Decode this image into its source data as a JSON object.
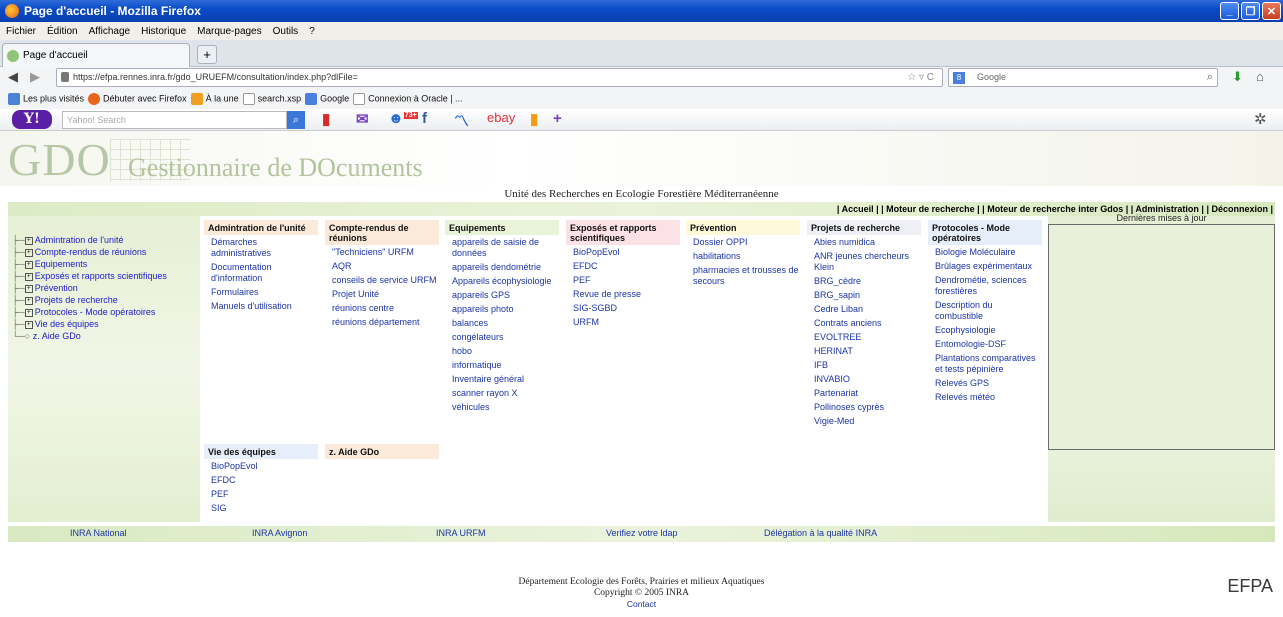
{
  "window": {
    "title": "Page d'accueil - Mozilla Firefox"
  },
  "menubar": [
    "Fichier",
    "Édition",
    "Affichage",
    "Historique",
    "Marque-pages",
    "Outils",
    "?"
  ],
  "tab": {
    "label": "Page d'accueil",
    "new_tab": "+"
  },
  "nav": {
    "url": "https://efpa.rennes.inra.fr/gdo_URUEFM/consultation/index.php?dlFile=",
    "search_placeholder": "Google"
  },
  "bookmarks": [
    "Les plus visités",
    "Débuter avec Firefox",
    "À la une",
    "search.xsp",
    "Google",
    "Connexion à Oracle | ..."
  ],
  "yahoo": {
    "search_placeholder": "Yahoo! Search",
    "badge": "73+"
  },
  "site": {
    "logo": "GDO",
    "logo_sub": "Gestionnaire de DOcuments",
    "unit_title": "Unité des Recherches en Ecologie Forestière Méditerranéenne",
    "top_links": "| Accueil | | Moteur de recherche | | Moteur de recherche inter Gdos | | Administration |     | Déconnexion |",
    "updates_title": "Dernières mises à jour"
  },
  "tree": [
    "Admintration de l'unité",
    "Compte-rendus de réunions",
    "Equipements",
    "Exposés et rapports scientifiques",
    "Prévention",
    "Projets de recherche",
    "Protocoles - Mode opératoires",
    "Vie des équipes",
    "z. Aide GDo"
  ],
  "categories": [
    {
      "title": "Admintration de l'unité",
      "color": "#fbe9d9",
      "items": [
        "Démarches administratives",
        "Documentation d'information",
        "Formulaires",
        "Manuels d'utilisation"
      ]
    },
    {
      "title": "Compte-rendus de réunions",
      "color": "#fbe9d9",
      "items": [
        "\"Techniciens\" URFM",
        "AQR",
        "conseils de service URFM",
        "Projet Unité",
        "réunions centre",
        "réunions département"
      ]
    },
    {
      "title": "Equipements",
      "color": "#e9f3d8",
      "items": [
        "appareils de saisie de données",
        "appareils dendométrie",
        "Appareils écophysiologie",
        "appareils GPS",
        "appareils photo",
        "balances",
        "congélateurs",
        "hobo",
        "informatique",
        "Inventaire général",
        "scanner rayon X",
        "véhicules"
      ]
    },
    {
      "title": "Exposés et rapports scientifiques",
      "color": "#fce2e6",
      "items": [
        "BioPopEvol",
        "EFDC",
        "PEF",
        "Revue de presse",
        "SIG-SGBD",
        "URFM"
      ]
    },
    {
      "title": "Prévention",
      "color": "#fdf8d8",
      "items": [
        "Dossier OPPI",
        "habilitations",
        "pharmacies et trousses de secours"
      ]
    },
    {
      "title": "Projets de recherche",
      "color": "#eef0f6",
      "items": [
        "Abies numidica",
        "ANR jeunes chercheurs Klein",
        "BRG_cèdre",
        "BRG_sapin",
        "Cedre Liban",
        "Contrats anciens",
        "EVOLTREE",
        "HERINAT",
        "IFB",
        "INVABIO",
        "Partenariat",
        "Pollinoses cyprès",
        "Vigie-Med"
      ]
    },
    {
      "title": "Protocoles - Mode opératoires",
      "color": "#e6eefa",
      "items": [
        "Biologie Moléculaire",
        "Brûlages expérimentaux",
        "Dendrométie, sciences forestières",
        "Description du combustible",
        "Ecophysiologie",
        "Entomologie-DSF",
        "Plantations comparatives et tests pépinière",
        "Relevés GPS",
        "Relevés météo"
      ]
    },
    {
      "title": "Vie des équipes",
      "color": "#e6eefa",
      "items": [
        "BioPopEvol",
        "EFDC",
        "PEF",
        "SIG"
      ]
    },
    {
      "title": "z. Aide GDo",
      "color": "#fbe9d9",
      "items": []
    }
  ],
  "footer_links": [
    "INRA National",
    "INRA Avignon",
    "INRA URFM",
    "Verifiez votre ldap",
    "Délégation à la qualité INRA"
  ],
  "footer": {
    "dept": "Département Ecologie des Forêts, Prairies et milieux Aquatiques",
    "copyright": "Copyright © 2005 INRA",
    "contact": "Contact",
    "efpa": "EFPA"
  }
}
